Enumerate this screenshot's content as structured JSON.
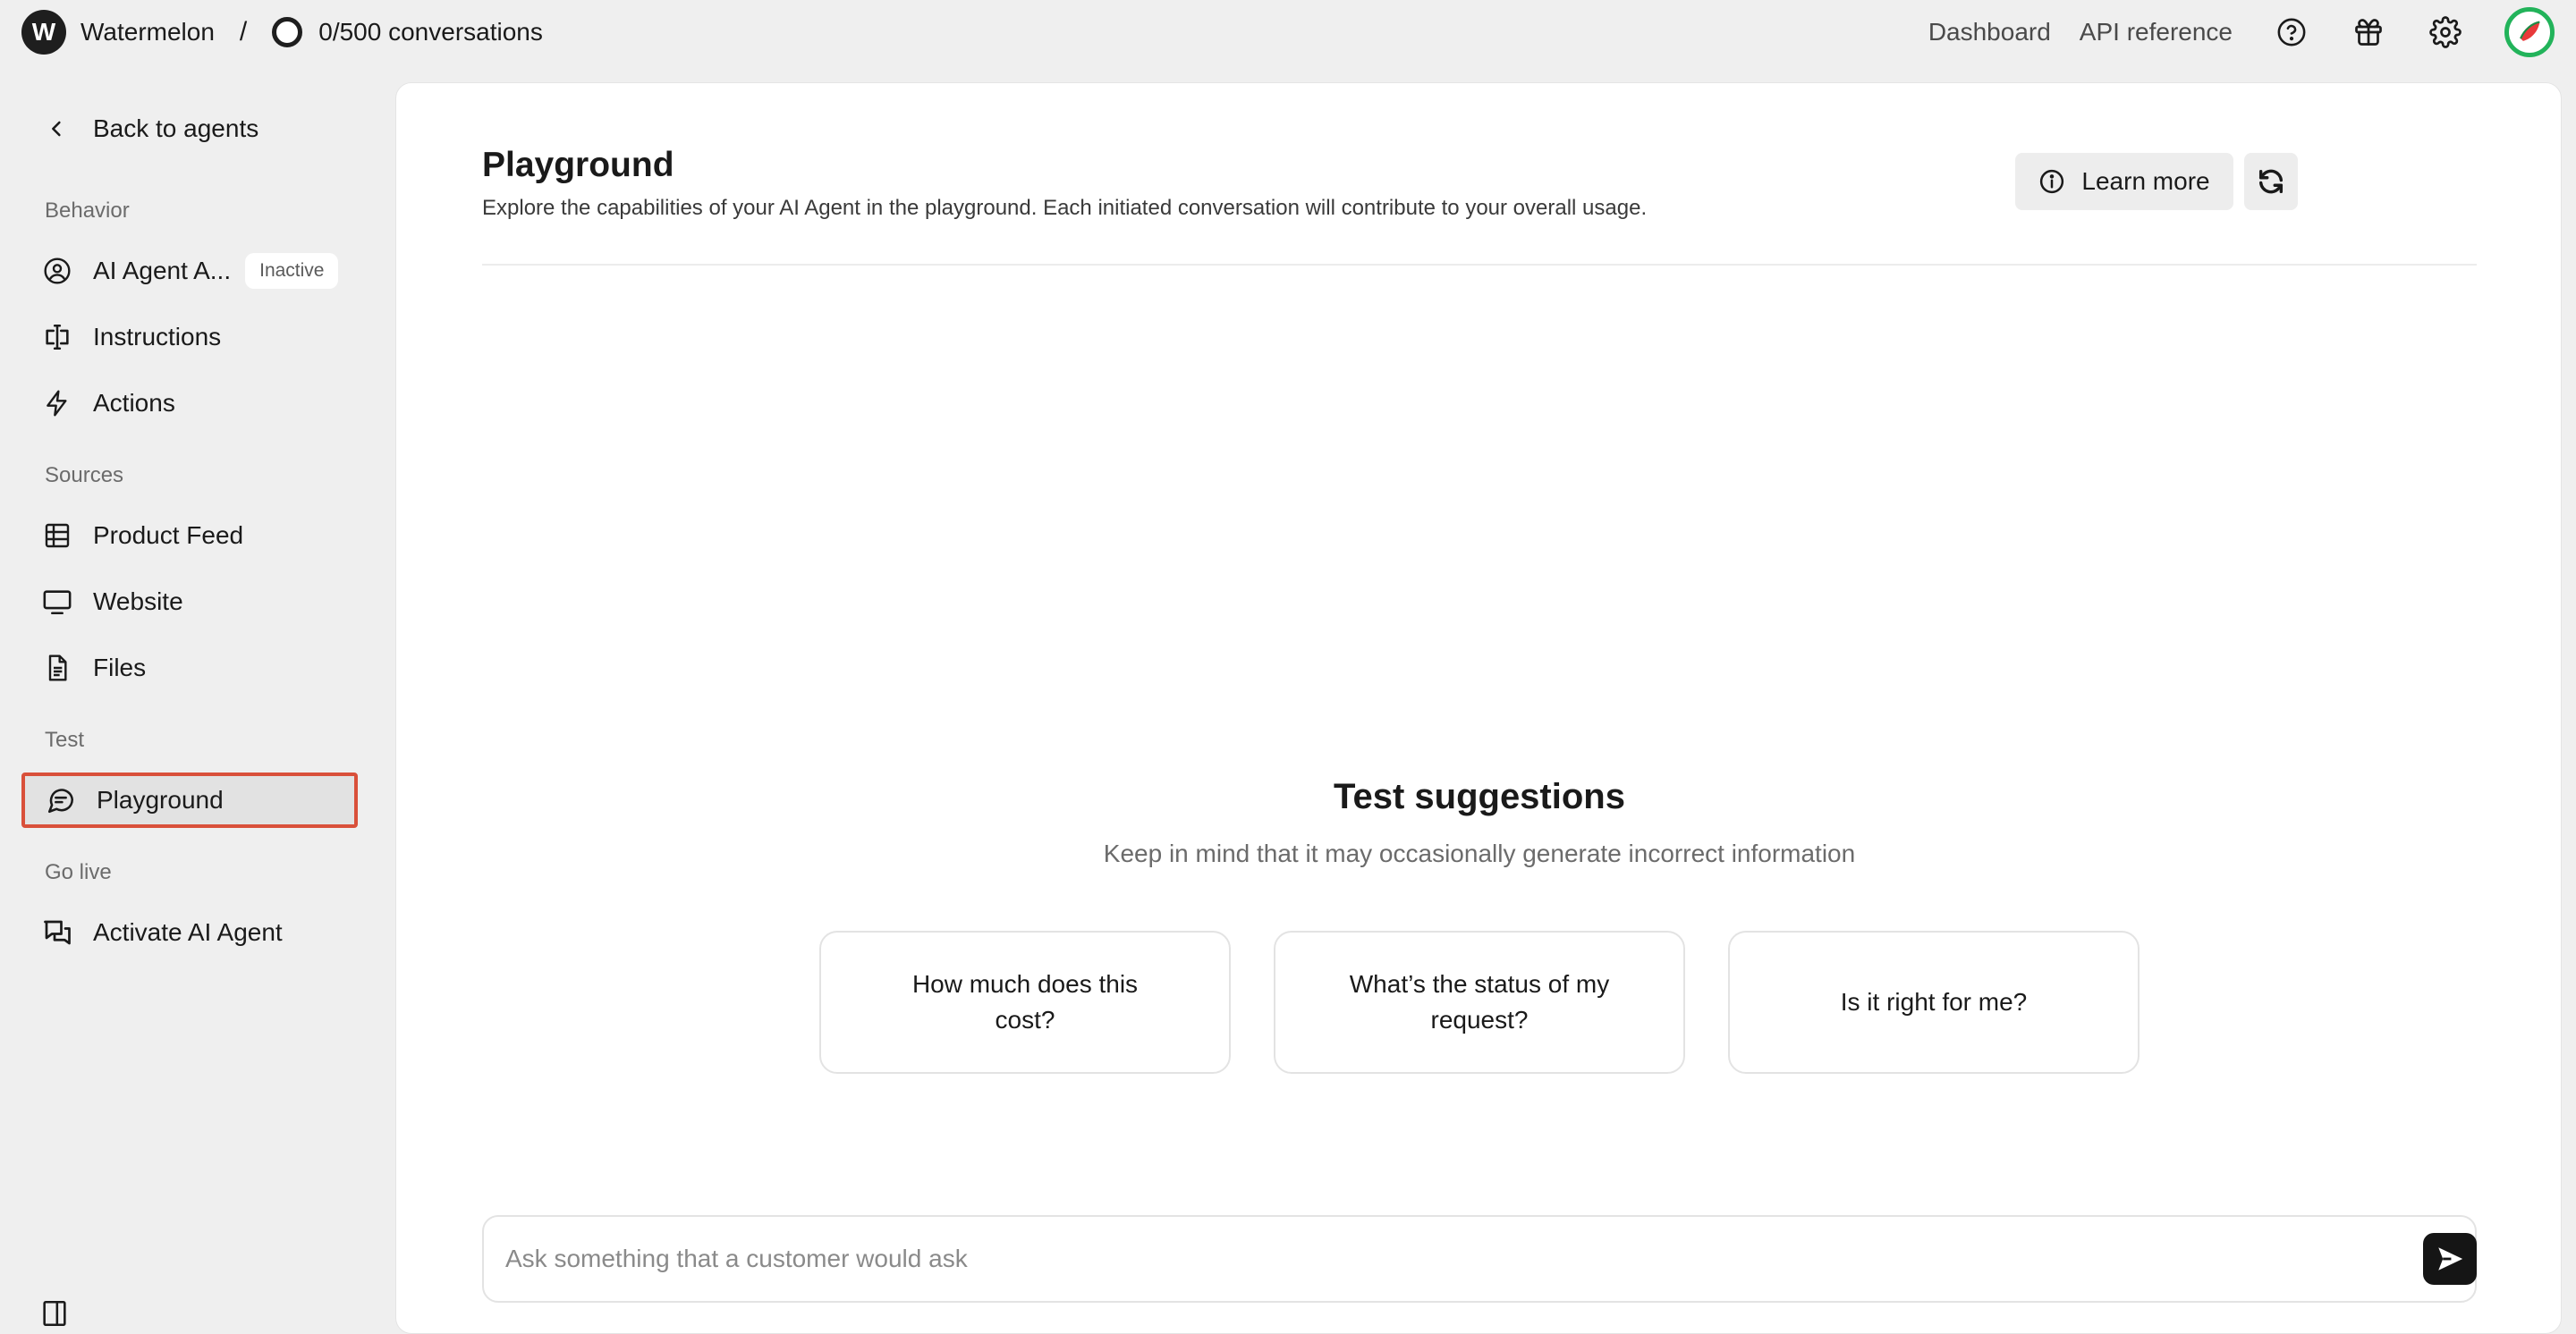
{
  "topbar": {
    "logo_letter": "W",
    "brand": "Watermelon",
    "separator": "/",
    "conversations": "0/500 conversations",
    "links": [
      "Dashboard",
      "API reference"
    ],
    "icons": [
      "help-icon",
      "gift-icon",
      "settings-icon",
      "avatar"
    ],
    "avatar_ring_color": "#22b35a"
  },
  "sidebar": {
    "back_label": "Back to agents",
    "sections": {
      "behavior": "Behavior",
      "sources": "Sources",
      "test": "Test",
      "go_live": "Go live"
    },
    "items": {
      "agent": {
        "label": "AI Agent A...",
        "badge": "Inactive",
        "icon": "user-circle-icon"
      },
      "instructions": {
        "label": "Instructions",
        "icon": "text-cursor-icon"
      },
      "actions": {
        "label": "Actions",
        "icon": "lightning-icon"
      },
      "product_feed": {
        "label": "Product Feed",
        "icon": "table-icon"
      },
      "website": {
        "label": "Website",
        "icon": "monitor-icon"
      },
      "files": {
        "label": "Files",
        "icon": "file-icon"
      },
      "playground": {
        "label": "Playground",
        "icon": "chat-bubble-icon",
        "active": true
      },
      "activate": {
        "label": "Activate AI Agent",
        "icon": "chat-bubbles-icon"
      }
    },
    "highlight_color": "#d9503a"
  },
  "main": {
    "title": "Playground",
    "description": "Explore the capabilities of your AI Agent in the playground. Each initiated conversation will contribute to your overall usage.",
    "learn_more": "Learn more",
    "suggestions": {
      "title": "Test suggestions",
      "subtitle": "Keep in mind that it may occasionally generate incorrect information",
      "cards": [
        "How much does this cost?",
        "What’s the status of my request?",
        "Is it right for me?"
      ]
    },
    "input": {
      "placeholder": "Ask something that a customer would ask",
      "value": ""
    }
  }
}
